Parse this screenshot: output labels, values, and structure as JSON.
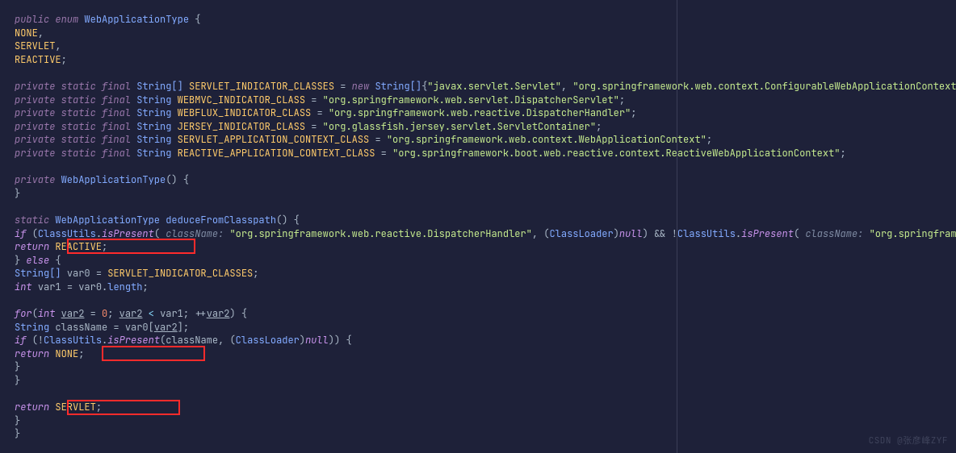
{
  "enum_decl": {
    "public": "public",
    "enum": "enum",
    "name": "WebApplicationType",
    "open": "{"
  },
  "consts": {
    "none": "NONE",
    "servlet": "SERVLET",
    "reactive": "REACTIVE"
  },
  "priv": "private",
  "stat": "static",
  "final": "final",
  "strT": "String",
  "strArr": "String[]",
  "newK": "new",
  "f1": {
    "name": "SERVLET_INDICATOR_CLASSES",
    "s1": "\"javax.servlet.Servlet\"",
    "s2": "\"org.springframework.web.context.ConfigurableWebApplicationContext\""
  },
  "f2": {
    "name": "WEBMVC_INDICATOR_CLASS",
    "v": "\"org.springframework.web.servlet.DispatcherServlet\""
  },
  "f3": {
    "name": "WEBFLUX_INDICATOR_CLASS",
    "v": "\"org.springframework.web.reactive.DispatcherHandler\""
  },
  "f4": {
    "name": "JERSEY_INDICATOR_CLASS",
    "v": "\"org.glassfish.jersey.servlet.ServletContainer\""
  },
  "f5": {
    "name": "SERVLET_APPLICATION_CONTEXT_CLASS",
    "v": "\"org.springframework.web.context.WebApplicationContext\""
  },
  "f6": {
    "name": "REACTIVE_APPLICATION_CONTEXT_CLASS",
    "v": "\"org.springframework.boot.web.reactive.context.ReactiveWebApplicationContext\""
  },
  "ctor": {
    "name": "WebApplicationType",
    "parens": "()"
  },
  "m": {
    "name": "deduceFromClasspath",
    "ret": "WebApplicationType"
  },
  "if": "if",
  "else": "else",
  "for": "for",
  "return": "return",
  "int": "int",
  "null": "null",
  "cls": "ClassLoader",
  "cu": "ClassUtils",
  "ip": "isPresent",
  "cnlbl": "className:",
  "arg1": "\"org.springframework.web.reactive.DispatcherHandler\"",
  "arg2": "\"org.springframework.we",
  "var0": "var0",
  "var1": "var1",
  "var2": "var2",
  "sic": "SERVLET_INDICATOR_CLASSES",
  "len": "length",
  "cname": "className",
  "watermark": "CSDN @张彦峰ZYF",
  "punct": {
    "comma": ",",
    "semi": ";",
    "eq": " = ",
    "amp": ") && !",
    "lp": "(",
    "rp": ")"
  },
  "chart_data": null
}
